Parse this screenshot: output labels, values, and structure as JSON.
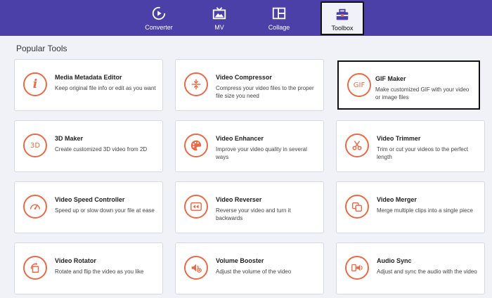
{
  "nav": {
    "tabs": [
      {
        "label": "Converter",
        "icon": "converter-icon"
      },
      {
        "label": "MV",
        "icon": "mv-icon"
      },
      {
        "label": "Collage",
        "icon": "collage-icon"
      },
      {
        "label": "Toolbox",
        "icon": "toolbox-icon",
        "active": true
      }
    ]
  },
  "section_title": "Popular Tools",
  "tools": [
    {
      "title": "Media Metadata Editor",
      "desc": "Keep original file info or edit as you want",
      "icon": "info-icon"
    },
    {
      "title": "Video Compressor",
      "desc": "Compress your video files to the proper file size you need",
      "icon": "compress-icon"
    },
    {
      "title": "GIF Maker",
      "desc": "Make customized GIF with your video or image files",
      "icon": "gif-icon",
      "icon_text": "GIF"
    },
    {
      "title": "3D Maker",
      "desc": "Create customized 3D video from 2D",
      "icon": "3d-icon",
      "icon_text": "3D"
    },
    {
      "title": "Video Enhancer",
      "desc": "Improve your video quality in several ways",
      "icon": "palette-icon"
    },
    {
      "title": "Video Trimmer",
      "desc": "Trim or cut your videos to the perfect length",
      "icon": "scissors-icon"
    },
    {
      "title": "Video Speed Controller",
      "desc": "Speed up or slow down your file at ease",
      "icon": "speedometer-icon"
    },
    {
      "title": "Video Reverser",
      "desc": "Reverse your video and turn it backwards",
      "icon": "rewind-icon"
    },
    {
      "title": "Video Merger",
      "desc": "Merge multiple clips into a single piece",
      "icon": "merge-icon"
    },
    {
      "title": "Video Rotator",
      "desc": "Rotate and flip the video as you like",
      "icon": "rotate-icon"
    },
    {
      "title": "Volume Booster",
      "desc": "Adjust the volume of the video",
      "icon": "volume-icon"
    },
    {
      "title": "Audio Sync",
      "desc": "Adjust and sync the audio with the video",
      "icon": "audio-sync-icon"
    }
  ],
  "colors": {
    "header": "#4b3fa8",
    "accent": "#ea6a45",
    "background": "#f1f2f8"
  }
}
